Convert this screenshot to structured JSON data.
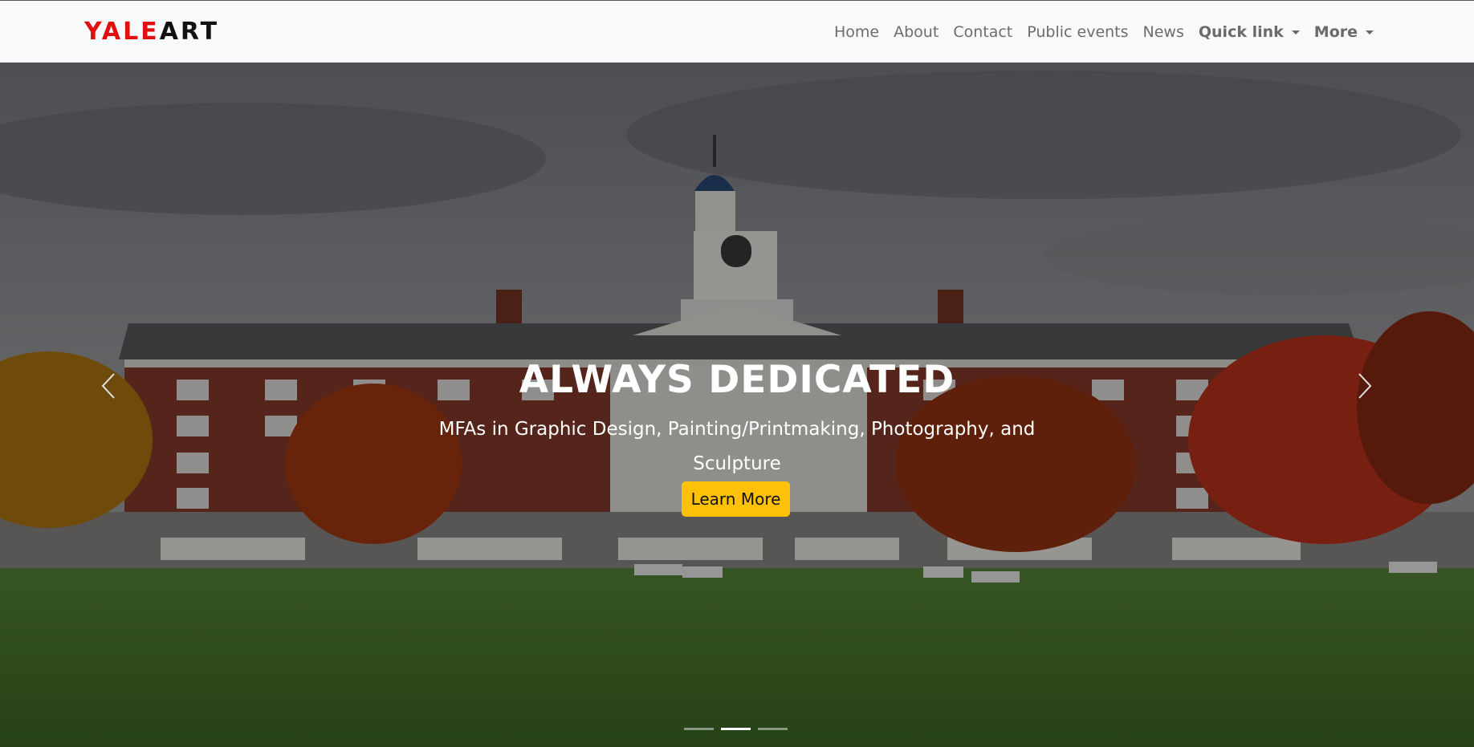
{
  "navbar": {
    "brand_part1": "YALE",
    "brand_part2": "ART",
    "links": [
      {
        "label": "Home"
      },
      {
        "label": "About"
      },
      {
        "label": "Contact"
      },
      {
        "label": "Public events"
      },
      {
        "label": "News"
      }
    ],
    "dropdowns": [
      {
        "label": "Quick link"
      },
      {
        "label": "More"
      }
    ]
  },
  "carousel": {
    "title": "ALWAYS DEDICATED",
    "subtitle": "MFAs in Graphic Design, Painting/Printmaking, Photography, and Sculpture",
    "button_label": "Learn More",
    "slide_count": 3,
    "active_slide": 2
  },
  "colors": {
    "brand_red": "#e01010",
    "brand_dark": "#111111",
    "button_yellow": "#ffc107",
    "navbar_bg": "#f8f9fa"
  }
}
